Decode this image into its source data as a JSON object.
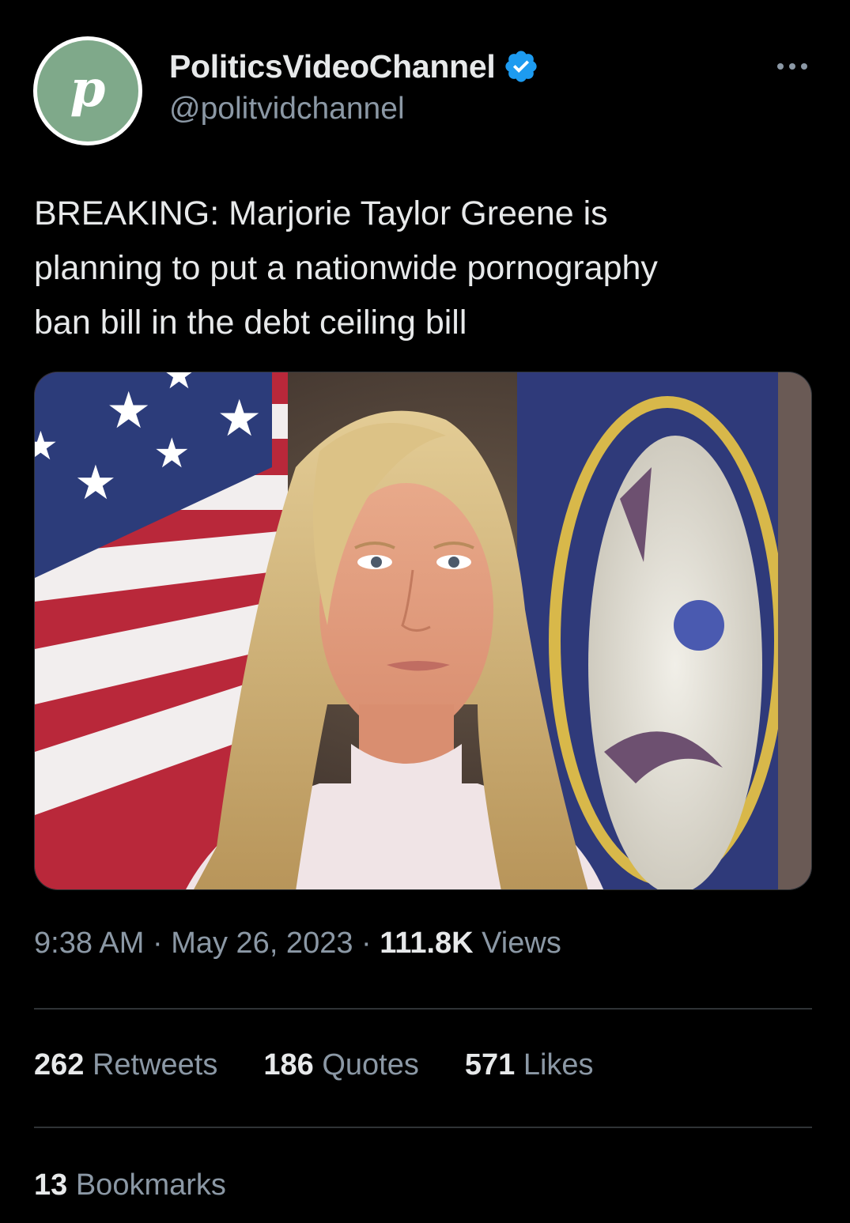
{
  "author": {
    "avatar_letter": "p",
    "avatar_color": "#7fa98a",
    "display_name": "PoliticsVideoChannel",
    "verified_icon": "verified-badge-icon",
    "verified_color": "#1d9bf0",
    "handle": "@politvidchannel"
  },
  "more_icon": "more-horizontal-icon",
  "tweet": {
    "text": "BREAKING: Marjorie Taylor Greene is\nplanning to put a nationwide pornography\nban bill in the debt ceiling bill",
    "media_icon": "photo-woman-in-front-of-flags"
  },
  "meta": {
    "time": "9:38 AM",
    "separator": " · ",
    "date": "May 26, 2023",
    "views_count": "111.8K",
    "views_label": " Views"
  },
  "stats": {
    "retweets_count": "262",
    "retweets_label": " Retweets",
    "quotes_count": "186",
    "quotes_label": " Quotes",
    "likes_count": "571",
    "likes_label": " Likes"
  },
  "bookmarks": {
    "count": "13",
    "label": " Bookmarks"
  },
  "colors": {
    "background": "#000000",
    "primary_text": "#e7e9ea",
    "secondary_text": "#8b98a5",
    "divider": "#2f3336"
  }
}
